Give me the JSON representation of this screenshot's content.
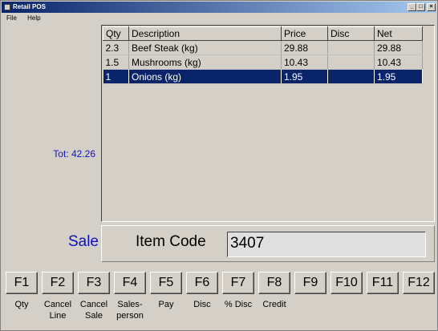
{
  "window": {
    "title": "Retail POS"
  },
  "titlebar_buttons": {
    "minimize": "_",
    "maximize": "□",
    "close": "×"
  },
  "menu": {
    "file": "File",
    "help": "Help"
  },
  "total": "Tot: 42.26",
  "grid": {
    "columns": [
      "Qty",
      "Description",
      "Price",
      "Disc",
      "Net"
    ],
    "rows": [
      {
        "qty": "2.3",
        "description": "Beef Steak (kg)",
        "price": "29.88",
        "disc": "",
        "net": "29.88",
        "selected": false
      },
      {
        "qty": "1.5",
        "description": "Mushrooms (kg)",
        "price": "10.43",
        "disc": "",
        "net": "10.43",
        "selected": false
      },
      {
        "qty": "1",
        "description": "Onions (kg)",
        "price": "1.95",
        "disc": "",
        "net": "1.95",
        "selected": true
      }
    ]
  },
  "mode": "Sale",
  "item_code": {
    "label": "Item Code",
    "value": "3407"
  },
  "function_keys": [
    {
      "key": "F1",
      "label": "Qty"
    },
    {
      "key": "F2",
      "label": "Cancel\nLine"
    },
    {
      "key": "F3",
      "label": "Cancel\nSale"
    },
    {
      "key": "F4",
      "label": "Sales-\nperson"
    },
    {
      "key": "F5",
      "label": "Pay"
    },
    {
      "key": "F6",
      "label": "Disc"
    },
    {
      "key": "F7",
      "label": "% Disc"
    },
    {
      "key": "F8",
      "label": "Credit"
    },
    {
      "key": "F9",
      "label": ""
    },
    {
      "key": "F10",
      "label": ""
    },
    {
      "key": "F11",
      "label": ""
    },
    {
      "key": "F12",
      "label": ""
    }
  ],
  "colors": {
    "accent": "#1010c0",
    "selection": "#0a246a",
    "face": "#d4d0c8"
  }
}
